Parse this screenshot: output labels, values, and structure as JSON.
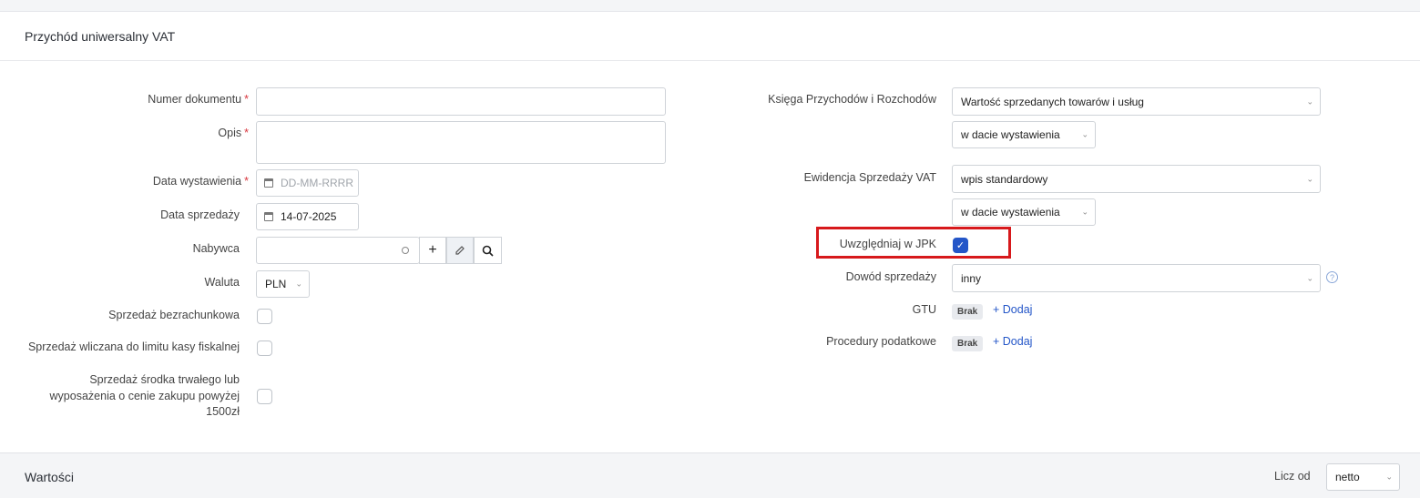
{
  "header": {
    "title": "Przychód uniwersalny VAT"
  },
  "left": {
    "numer_label": "Numer dokumentu",
    "opis_label": "Opis",
    "required_mark": "*",
    "data_wyst_label": "Data wystawienia",
    "data_wyst_placeholder": "DD-MM-RRRR",
    "data_sprz_label": "Data sprzedaży",
    "data_sprz_value": "14-07-2025",
    "nabywca_label": "Nabywca",
    "waluta_label": "Waluta",
    "waluta_value": "PLN",
    "bezrach_label": "Sprzedaż bezrachunkowa",
    "limit_label": "Sprzedaż wliczana do limitu kasy fiskalnej",
    "srodek_line1": "Sprzedaż środka trwałego lub",
    "srodek_line2": "wyposażenia o cenie zakupu powyżej",
    "srodek_line3": "1500zł"
  },
  "right": {
    "kpir_label": "Księga Przychodów i Rozchodów",
    "kpir_value": "Wartość sprzedanych towarów i usług",
    "kpir_date_value": "w dacie wystawienia",
    "ewid_label": "Ewidencja Sprzedaży VAT",
    "ewid_value": "wpis standardowy",
    "ewid_date_value": "w dacie wystawienia",
    "jpk_label": "Uwzględniaj w JPK",
    "jpk_checked": true,
    "dowod_label": "Dowód sprzedaży",
    "dowod_value": "inny",
    "gtu_label": "GTU",
    "gtu_badge": "Brak",
    "gtu_add": "+ Dodaj",
    "proc_label": "Procedury podatkowe",
    "proc_badge": "Brak",
    "proc_add": "+ Dodaj"
  },
  "footer": {
    "title": "Wartości",
    "licz_label": "Licz od",
    "licz_value": "netto"
  },
  "colors": {
    "accent": "#2456c8",
    "required": "#d9363e",
    "highlight": "#d7191c"
  }
}
